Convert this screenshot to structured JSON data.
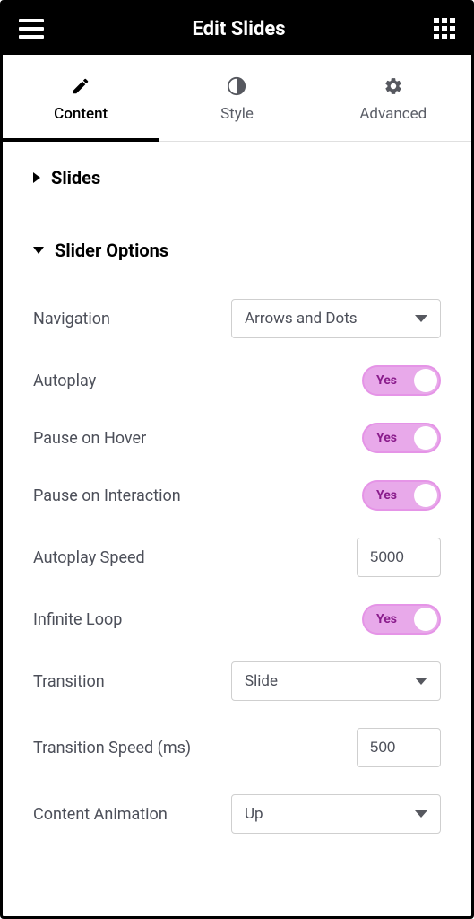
{
  "header": {
    "title": "Edit Slides"
  },
  "tabs": [
    {
      "label": "Content",
      "active": true
    },
    {
      "label": "Style",
      "active": false
    },
    {
      "label": "Advanced",
      "active": false
    }
  ],
  "sections": {
    "slides": {
      "title": "Slides",
      "expanded": false
    },
    "slider_options": {
      "title": "Slider Options",
      "expanded": true,
      "fields": {
        "navigation": {
          "label": "Navigation",
          "value": "Arrows and Dots"
        },
        "autoplay": {
          "label": "Autoplay",
          "value": "Yes"
        },
        "pause_on_hover": {
          "label": "Pause on Hover",
          "value": "Yes"
        },
        "pause_on_interaction": {
          "label": "Pause on Interaction",
          "value": "Yes"
        },
        "autoplay_speed": {
          "label": "Autoplay Speed",
          "value": "5000"
        },
        "infinite_loop": {
          "label": "Infinite Loop",
          "value": "Yes"
        },
        "transition": {
          "label": "Transition",
          "value": "Slide"
        },
        "transition_speed": {
          "label": "Transition Speed (ms)",
          "value": "500"
        },
        "content_animation": {
          "label": "Content Animation",
          "value": "Up"
        }
      }
    }
  }
}
